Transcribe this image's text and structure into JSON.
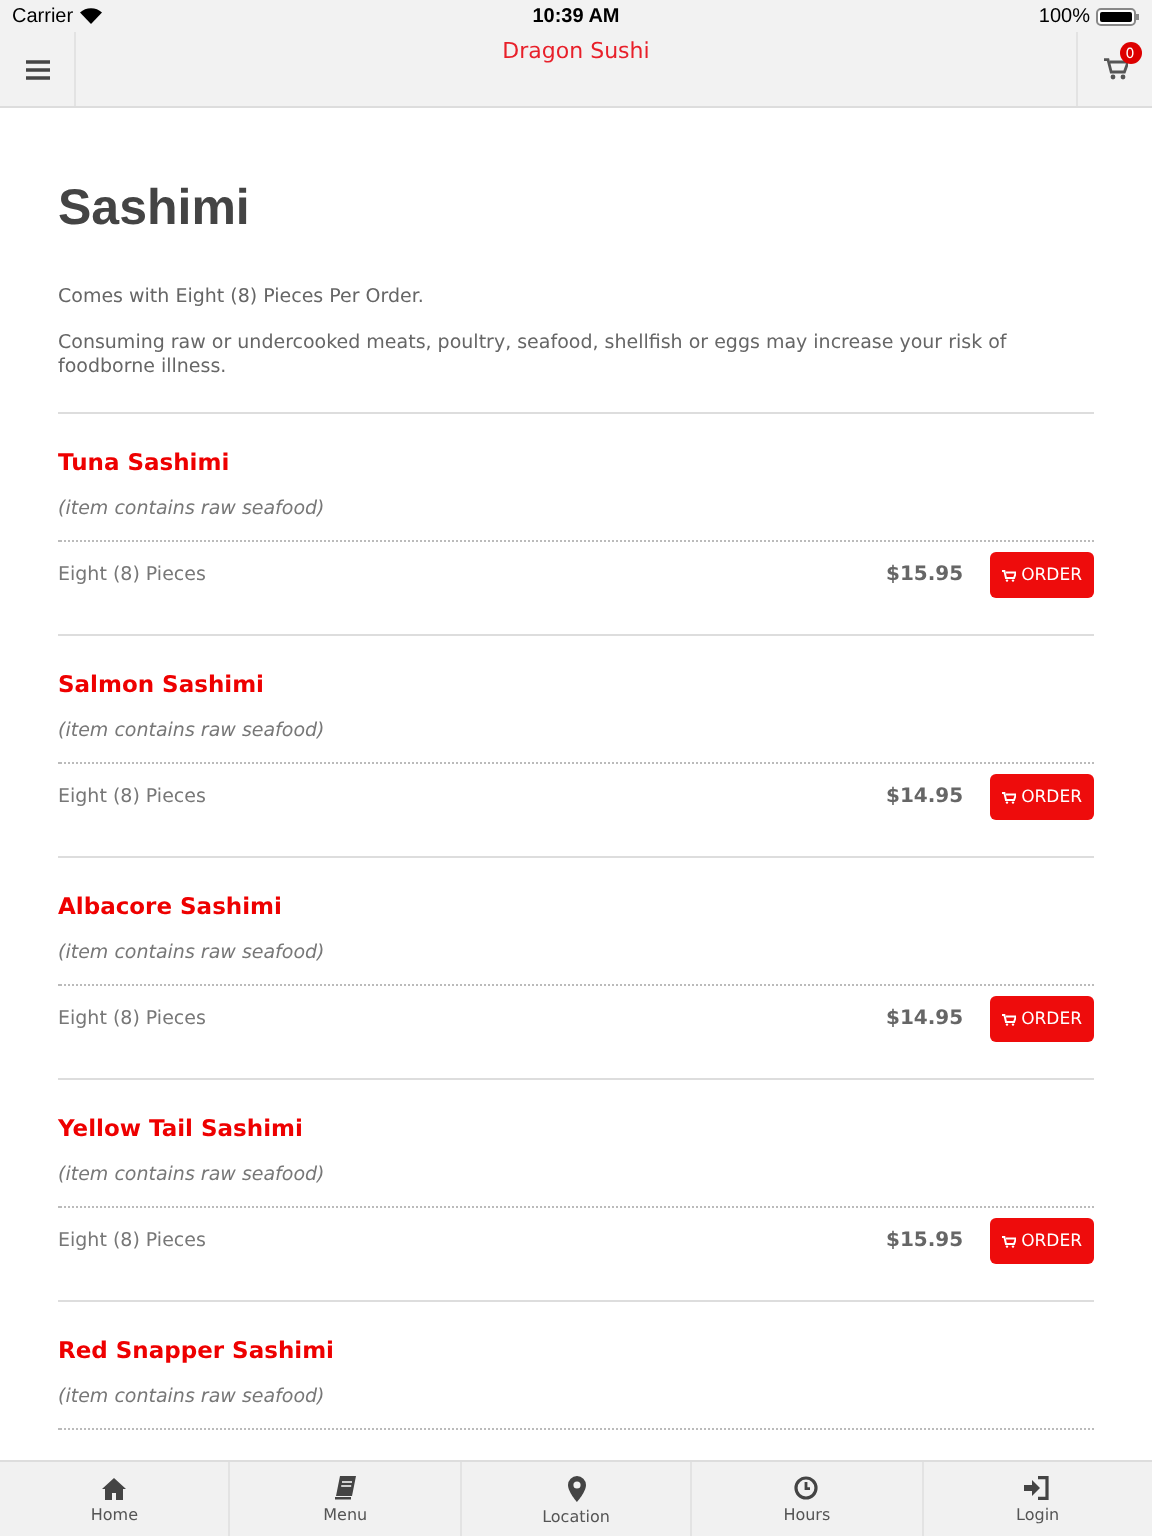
{
  "status_bar": {
    "carrier": "Carrier",
    "time": "10:39 AM",
    "battery": "100%"
  },
  "header": {
    "title": "Dragon Sushi",
    "cart_count": "0"
  },
  "page": {
    "title": "Sashimi",
    "notes": [
      "Comes with Eight (8) Pieces Per Order.",
      "Consuming raw or undercooked meats, poultry, seafood, shellfish or eggs may increase your risk of foodborne illness."
    ]
  },
  "items": [
    {
      "name": "Tuna Sashimi",
      "note": "(item contains raw seafood)",
      "portion": "Eight (8) Pieces",
      "price": "$15.95",
      "button": "ORDER"
    },
    {
      "name": "Salmon Sashimi",
      "note": "(item contains raw seafood)",
      "portion": "Eight (8) Pieces",
      "price": "$14.95",
      "button": "ORDER"
    },
    {
      "name": "Albacore Sashimi",
      "note": "(item contains raw seafood)",
      "portion": "Eight (8) Pieces",
      "price": "$14.95",
      "button": "ORDER"
    },
    {
      "name": "Yellow Tail Sashimi",
      "note": "(item contains raw seafood)",
      "portion": "Eight (8) Pieces",
      "price": "$15.95",
      "button": "ORDER"
    },
    {
      "name": "Red Snapper Sashimi",
      "note": "(item contains raw seafood)"
    }
  ],
  "tab_bar": [
    {
      "kind": "home",
      "label": "Home"
    },
    {
      "kind": "menu",
      "label": "Menu"
    },
    {
      "kind": "location",
      "label": "Location"
    },
    {
      "kind": "hours",
      "label": "Hours"
    },
    {
      "kind": "login",
      "label": "Login"
    }
  ]
}
